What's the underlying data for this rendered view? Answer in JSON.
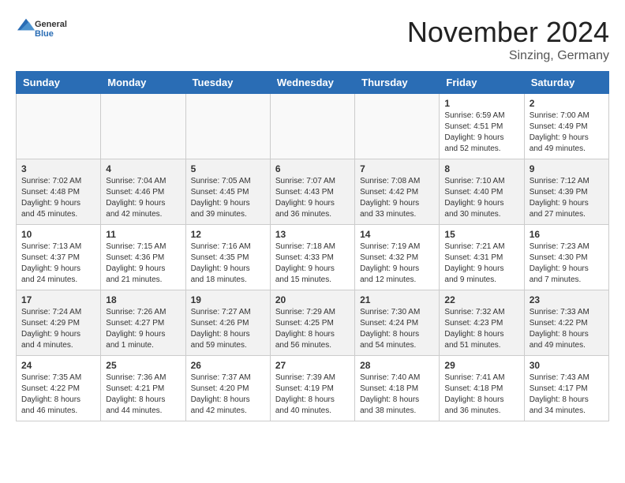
{
  "header": {
    "logo": {
      "general": "General",
      "blue": "Blue"
    },
    "title": "November 2024",
    "location": "Sinzing, Germany"
  },
  "weekdays": [
    "Sunday",
    "Monday",
    "Tuesday",
    "Wednesday",
    "Thursday",
    "Friday",
    "Saturday"
  ],
  "weeks": [
    [
      {
        "day": "",
        "info": ""
      },
      {
        "day": "",
        "info": ""
      },
      {
        "day": "",
        "info": ""
      },
      {
        "day": "",
        "info": ""
      },
      {
        "day": "",
        "info": ""
      },
      {
        "day": "1",
        "info": "Sunrise: 6:59 AM\nSunset: 4:51 PM\nDaylight: 9 hours\nand 52 minutes."
      },
      {
        "day": "2",
        "info": "Sunrise: 7:00 AM\nSunset: 4:49 PM\nDaylight: 9 hours\nand 49 minutes."
      }
    ],
    [
      {
        "day": "3",
        "info": "Sunrise: 7:02 AM\nSunset: 4:48 PM\nDaylight: 9 hours\nand 45 minutes."
      },
      {
        "day": "4",
        "info": "Sunrise: 7:04 AM\nSunset: 4:46 PM\nDaylight: 9 hours\nand 42 minutes."
      },
      {
        "day": "5",
        "info": "Sunrise: 7:05 AM\nSunset: 4:45 PM\nDaylight: 9 hours\nand 39 minutes."
      },
      {
        "day": "6",
        "info": "Sunrise: 7:07 AM\nSunset: 4:43 PM\nDaylight: 9 hours\nand 36 minutes."
      },
      {
        "day": "7",
        "info": "Sunrise: 7:08 AM\nSunset: 4:42 PM\nDaylight: 9 hours\nand 33 minutes."
      },
      {
        "day": "8",
        "info": "Sunrise: 7:10 AM\nSunset: 4:40 PM\nDaylight: 9 hours\nand 30 minutes."
      },
      {
        "day": "9",
        "info": "Sunrise: 7:12 AM\nSunset: 4:39 PM\nDaylight: 9 hours\nand 27 minutes."
      }
    ],
    [
      {
        "day": "10",
        "info": "Sunrise: 7:13 AM\nSunset: 4:37 PM\nDaylight: 9 hours\nand 24 minutes."
      },
      {
        "day": "11",
        "info": "Sunrise: 7:15 AM\nSunset: 4:36 PM\nDaylight: 9 hours\nand 21 minutes."
      },
      {
        "day": "12",
        "info": "Sunrise: 7:16 AM\nSunset: 4:35 PM\nDaylight: 9 hours\nand 18 minutes."
      },
      {
        "day": "13",
        "info": "Sunrise: 7:18 AM\nSunset: 4:33 PM\nDaylight: 9 hours\nand 15 minutes."
      },
      {
        "day": "14",
        "info": "Sunrise: 7:19 AM\nSunset: 4:32 PM\nDaylight: 9 hours\nand 12 minutes."
      },
      {
        "day": "15",
        "info": "Sunrise: 7:21 AM\nSunset: 4:31 PM\nDaylight: 9 hours\nand 9 minutes."
      },
      {
        "day": "16",
        "info": "Sunrise: 7:23 AM\nSunset: 4:30 PM\nDaylight: 9 hours\nand 7 minutes."
      }
    ],
    [
      {
        "day": "17",
        "info": "Sunrise: 7:24 AM\nSunset: 4:29 PM\nDaylight: 9 hours\nand 4 minutes."
      },
      {
        "day": "18",
        "info": "Sunrise: 7:26 AM\nSunset: 4:27 PM\nDaylight: 9 hours\nand 1 minute."
      },
      {
        "day": "19",
        "info": "Sunrise: 7:27 AM\nSunset: 4:26 PM\nDaylight: 8 hours\nand 59 minutes."
      },
      {
        "day": "20",
        "info": "Sunrise: 7:29 AM\nSunset: 4:25 PM\nDaylight: 8 hours\nand 56 minutes."
      },
      {
        "day": "21",
        "info": "Sunrise: 7:30 AM\nSunset: 4:24 PM\nDaylight: 8 hours\nand 54 minutes."
      },
      {
        "day": "22",
        "info": "Sunrise: 7:32 AM\nSunset: 4:23 PM\nDaylight: 8 hours\nand 51 minutes."
      },
      {
        "day": "23",
        "info": "Sunrise: 7:33 AM\nSunset: 4:22 PM\nDaylight: 8 hours\nand 49 minutes."
      }
    ],
    [
      {
        "day": "24",
        "info": "Sunrise: 7:35 AM\nSunset: 4:22 PM\nDaylight: 8 hours\nand 46 minutes."
      },
      {
        "day": "25",
        "info": "Sunrise: 7:36 AM\nSunset: 4:21 PM\nDaylight: 8 hours\nand 44 minutes."
      },
      {
        "day": "26",
        "info": "Sunrise: 7:37 AM\nSunset: 4:20 PM\nDaylight: 8 hours\nand 42 minutes."
      },
      {
        "day": "27",
        "info": "Sunrise: 7:39 AM\nSunset: 4:19 PM\nDaylight: 8 hours\nand 40 minutes."
      },
      {
        "day": "28",
        "info": "Sunrise: 7:40 AM\nSunset: 4:18 PM\nDaylight: 8 hours\nand 38 minutes."
      },
      {
        "day": "29",
        "info": "Sunrise: 7:41 AM\nSunset: 4:18 PM\nDaylight: 8 hours\nand 36 minutes."
      },
      {
        "day": "30",
        "info": "Sunrise: 7:43 AM\nSunset: 4:17 PM\nDaylight: 8 hours\nand 34 minutes."
      }
    ]
  ]
}
